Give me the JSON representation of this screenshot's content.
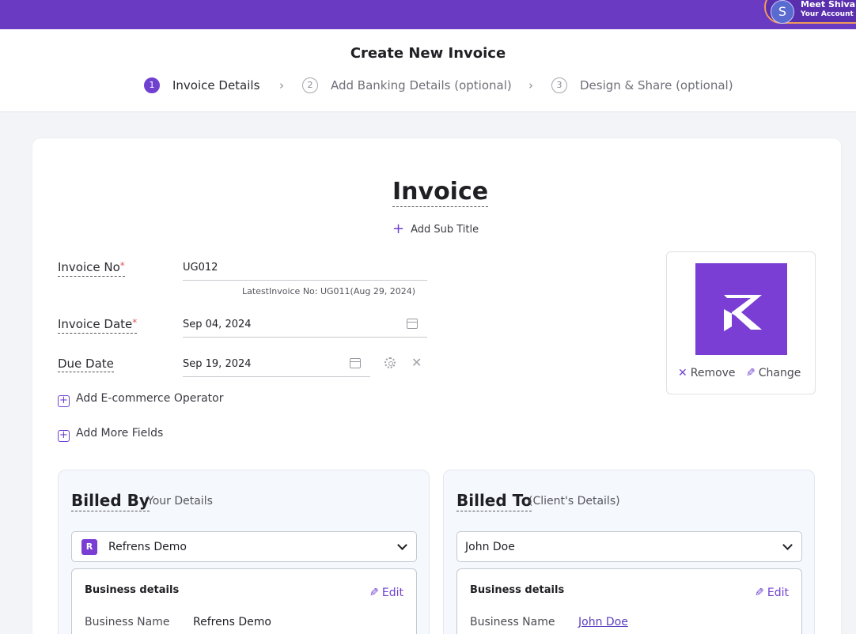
{
  "topbar": {
    "account_initial": "S",
    "account_name": "Meet Shivani",
    "account_role": "Your Account M"
  },
  "header": {
    "title": "Create New Invoice",
    "steps": [
      {
        "num": "1",
        "label": "Invoice Details"
      },
      {
        "num": "2",
        "label": "Add Banking Details (optional)"
      },
      {
        "num": "3",
        "label": "Design & Share (optional)"
      }
    ]
  },
  "invoice": {
    "title": "Invoice",
    "add_subtitle": "Add Sub Title",
    "required_mark": "*",
    "invoice_no_label": "Invoice No",
    "invoice_no_value": "UG012",
    "latest_hint": "LatestInvoice No: UG011(Aug 29, 2024)",
    "invoice_date_label": "Invoice Date",
    "invoice_date_value": "Sep 04, 2024",
    "due_date_label": "Due Date",
    "due_date_value": "Sep 19, 2024",
    "add_ecommerce": "Add E-commerce Operator",
    "add_more_fields": "Add More Fields"
  },
  "logo": {
    "remove_label": "Remove",
    "change_label": "Change"
  },
  "billed_by": {
    "title": "Billed By",
    "subtitle": "Your Details",
    "selected": "Refrens Demo",
    "business_heading": "Business details",
    "edit_label": "Edit",
    "business_name_key": "Business Name",
    "business_name_value": "Refrens Demo"
  },
  "billed_to": {
    "title": "Billed To",
    "subtitle": "(Client's Details)",
    "selected": "John Doe",
    "business_heading": "Business details",
    "edit_label": "Edit",
    "business_name_key": "Business Name",
    "business_name_value": "John Doe"
  },
  "colors": {
    "brand": "#6a3bc2",
    "accent": "#7041d0",
    "required": "#e05656"
  }
}
